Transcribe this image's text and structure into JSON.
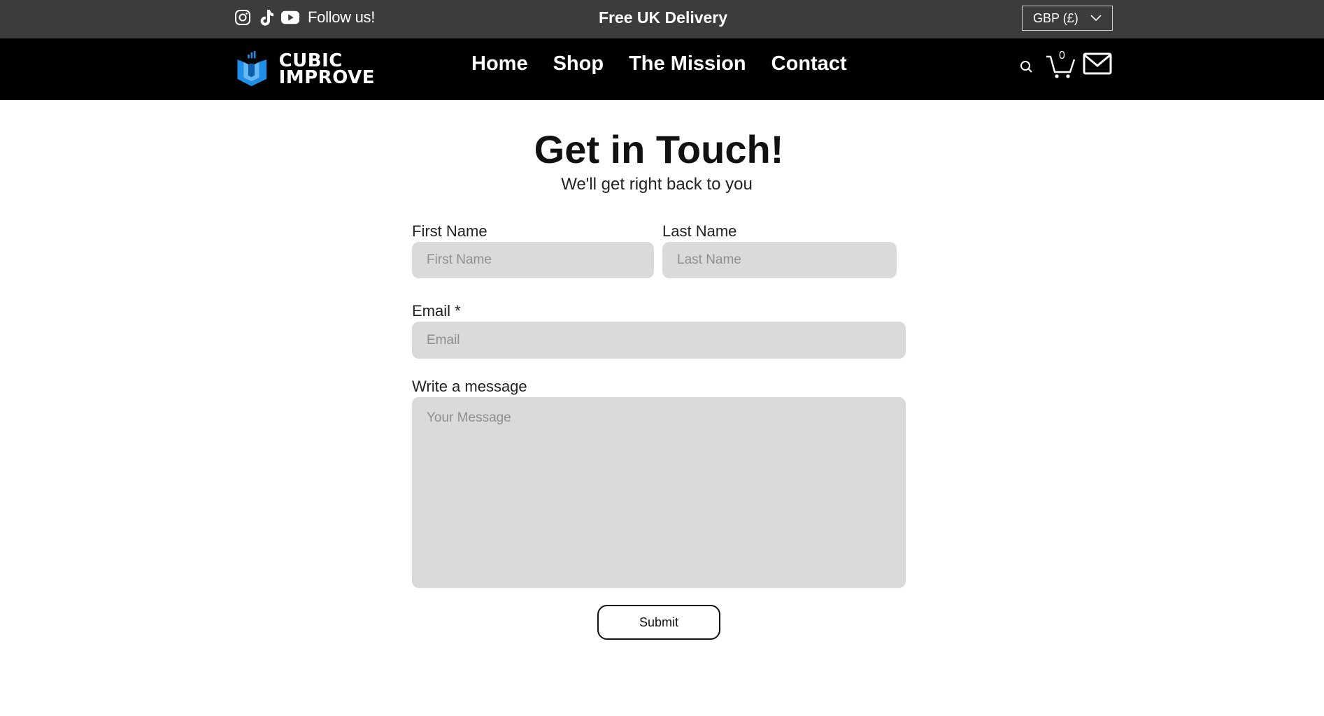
{
  "topbar": {
    "social_icons": [
      "instagram-icon",
      "tiktok-icon",
      "youtube-icon"
    ],
    "follow_text": "Follow us!",
    "promo_text": "Free UK Delivery",
    "currency": "GBP (£)"
  },
  "header": {
    "logo_line1": "CUBIC",
    "logo_line2": "IMPROVE",
    "nav": [
      "Home",
      "Shop",
      "The Mission",
      "Contact"
    ],
    "cart_count": "0",
    "icons": [
      "search-icon",
      "cart-icon",
      "mail-icon"
    ]
  },
  "contact": {
    "title": "Get in Touch!",
    "subtitle": "We'll get right back to you",
    "first_name_label": "First Name",
    "first_name_placeholder": "First Name",
    "last_name_label": "Last Name",
    "last_name_placeholder": "Last Name",
    "email_label": "Email *",
    "email_placeholder": "Email",
    "message_label": "Write a message",
    "message_placeholder": "Your Message",
    "submit_label": "Submit"
  },
  "colors": {
    "topbar_bg": "#3c3c3c",
    "navbar_bg": "#000000",
    "field_bg": "#dadada",
    "logo_blue": "#1e8fe6"
  }
}
